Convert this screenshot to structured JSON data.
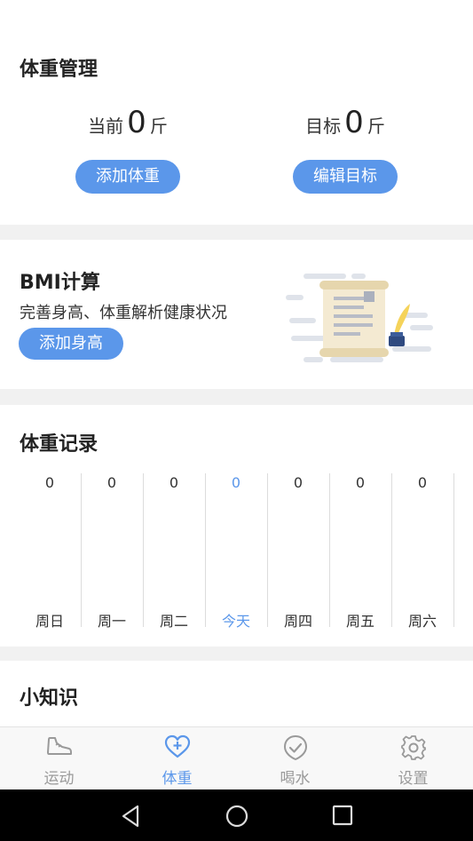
{
  "weight": {
    "title": "体重管理",
    "current": {
      "label": "当前",
      "value": "0",
      "unit": "斤"
    },
    "goal": {
      "label": "目标",
      "value": "0",
      "unit": "斤"
    },
    "add_button": "添加体重",
    "edit_button": "编辑目标"
  },
  "bmi": {
    "title": "BMI计算",
    "subtitle": "完善身高、体重解析健康状况",
    "button": "添加身高",
    "illustration": "document-quill-illustration"
  },
  "records": {
    "title": "体重记录",
    "days": [
      {
        "value": "0",
        "label": "周日"
      },
      {
        "value": "0",
        "label": "周一"
      },
      {
        "value": "0",
        "label": "周二"
      },
      {
        "value": "0",
        "label": "今天"
      },
      {
        "value": "0",
        "label": "周四"
      },
      {
        "value": "0",
        "label": "周五"
      },
      {
        "value": "0",
        "label": "周六"
      }
    ],
    "today_index": 3
  },
  "tips": {
    "title": "小知识"
  },
  "nav": {
    "items": [
      {
        "label": "运动",
        "icon": "sneaker-icon"
      },
      {
        "label": "体重",
        "icon": "heart-plus-icon"
      },
      {
        "label": "喝水",
        "icon": "check-drop-icon"
      },
      {
        "label": "设置",
        "icon": "gear-icon"
      }
    ],
    "active_index": 1
  },
  "colors": {
    "accent": "#5b97ea",
    "inactive": "#9a9a9a"
  }
}
